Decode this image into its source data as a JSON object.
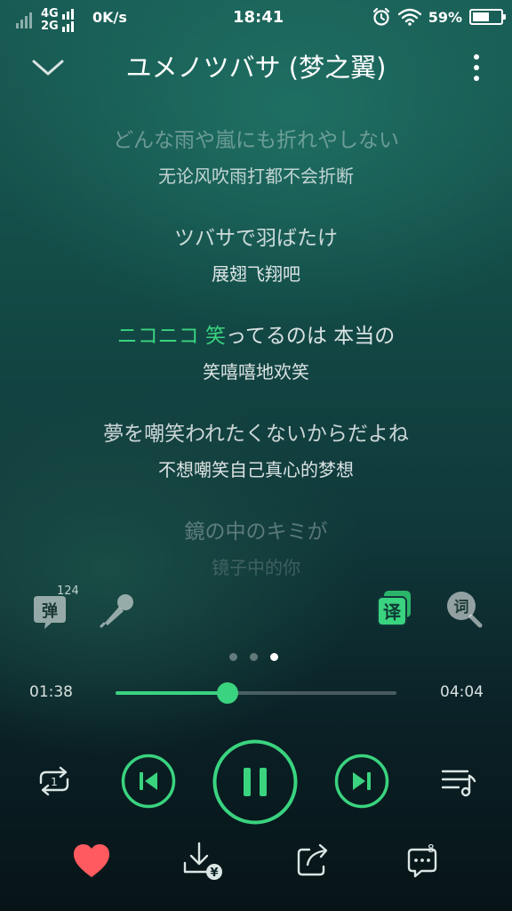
{
  "status_bar": {
    "net_top": "4G",
    "net_bottom": "2G",
    "speed": "0K/s",
    "time": "18:41",
    "battery_pct": "59%",
    "battery_level": 0.59
  },
  "header": {
    "title": "ユメノツバサ (梦之翼)"
  },
  "lyrics": [
    {
      "jp": "どんな雨や嵐にも折れやしない",
      "cn": "无论风吹雨打都不会折断",
      "jp_opacity": 0.35,
      "cn_opacity": 0.72
    },
    {
      "jp": "ツバサで羽ばたけ",
      "cn": "展翅飞翔吧",
      "jp_opacity": 0.78,
      "cn_opacity": 0.85
    },
    {
      "jp_sung": "ニコニコ 笑",
      "jp_rest": "ってるのは 本当の",
      "cn": "笑嘻嘻地欢笑",
      "jp_opacity": 0.85,
      "cn_opacity": 0.85
    },
    {
      "jp": "夢を嘲笑われたくないからだよね",
      "cn": "不想嘲笑自己真心的梦想",
      "jp_opacity": 0.78,
      "cn_opacity": 0.85
    },
    {
      "jp": "鏡の中のキミが",
      "cn": "镜子中的你",
      "jp_opacity": 0.3,
      "cn_opacity": 0.18
    }
  ],
  "tools": {
    "danmu_label": "弹",
    "danmu_count": "124",
    "translate_label": "译",
    "lyric_label": "词"
  },
  "pager": {
    "count": 3,
    "active": 2
  },
  "playback": {
    "current_time": "01:38",
    "total_time": "04:04",
    "progress": 0.4,
    "loop_label": "1"
  },
  "actions": {
    "download_badge": "¥",
    "comment_count": "8"
  },
  "colors": {
    "accent": "#3ad37f",
    "like": "#ff5a5f"
  }
}
